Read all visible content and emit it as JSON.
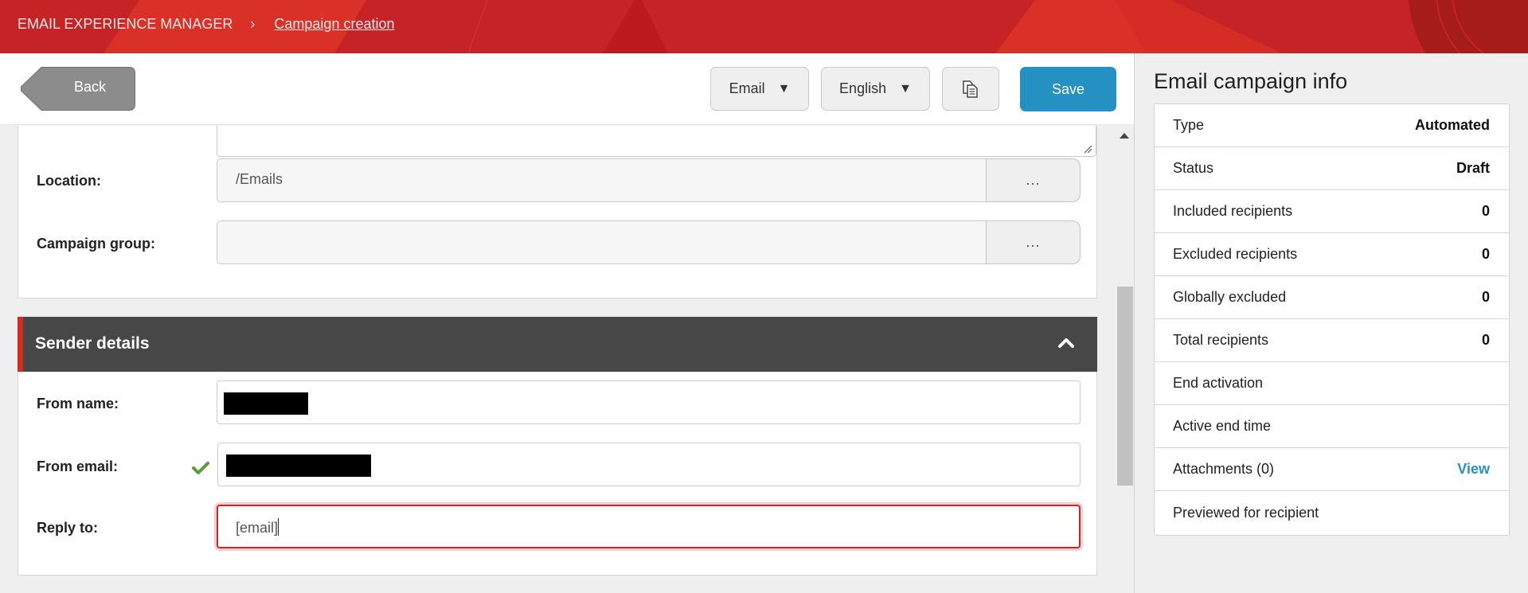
{
  "header": {
    "app_name": "EMAIL EXPERIENCE MANAGER",
    "separator": "›",
    "current_page": "Campaign creation",
    "brand_color": "#c62326"
  },
  "toolbar": {
    "back_label": "Back",
    "channel_select": {
      "value": "Email",
      "caret": "▼"
    },
    "language_select": {
      "value": "English",
      "caret": "▼"
    },
    "copy_icon": "copy-document-icon",
    "save_label": "Save",
    "save_color": "#2591c3"
  },
  "general_section": {
    "location": {
      "label": "Location:",
      "value": "/Emails",
      "browse_label": "..."
    },
    "campaign_group": {
      "label": "Campaign group:",
      "value": "",
      "browse_label": "..."
    }
  },
  "sender_section": {
    "title": "Sender details",
    "collapse_icon": "chevron-up-icon",
    "from_name": {
      "label": "From name:",
      "value": "[redacted]"
    },
    "from_email": {
      "label": "From email:",
      "value": "[redacted]",
      "status_icon": "checkmark-icon",
      "status_color": "#5a9a3a"
    },
    "reply_to": {
      "label": "Reply to:",
      "value": "[email]",
      "error_color": "#c52a2a"
    }
  },
  "info_panel": {
    "title": "Email campaign info",
    "rows": [
      {
        "label": "Type",
        "value": "Automated"
      },
      {
        "label": "Status",
        "value": "Draft"
      },
      {
        "label": "Included recipients",
        "value": "0"
      },
      {
        "label": "Excluded recipients",
        "value": "0"
      },
      {
        "label": "Globally excluded",
        "value": "0"
      },
      {
        "label": "Total recipients",
        "value": "0"
      },
      {
        "label": "End activation",
        "value": ""
      },
      {
        "label": "Active end time",
        "value": ""
      },
      {
        "label": "Attachments (0)",
        "value": "View",
        "is_link": true
      },
      {
        "label": "Previewed for recipient",
        "value": ""
      }
    ],
    "link_color": "#2a8fc1"
  }
}
